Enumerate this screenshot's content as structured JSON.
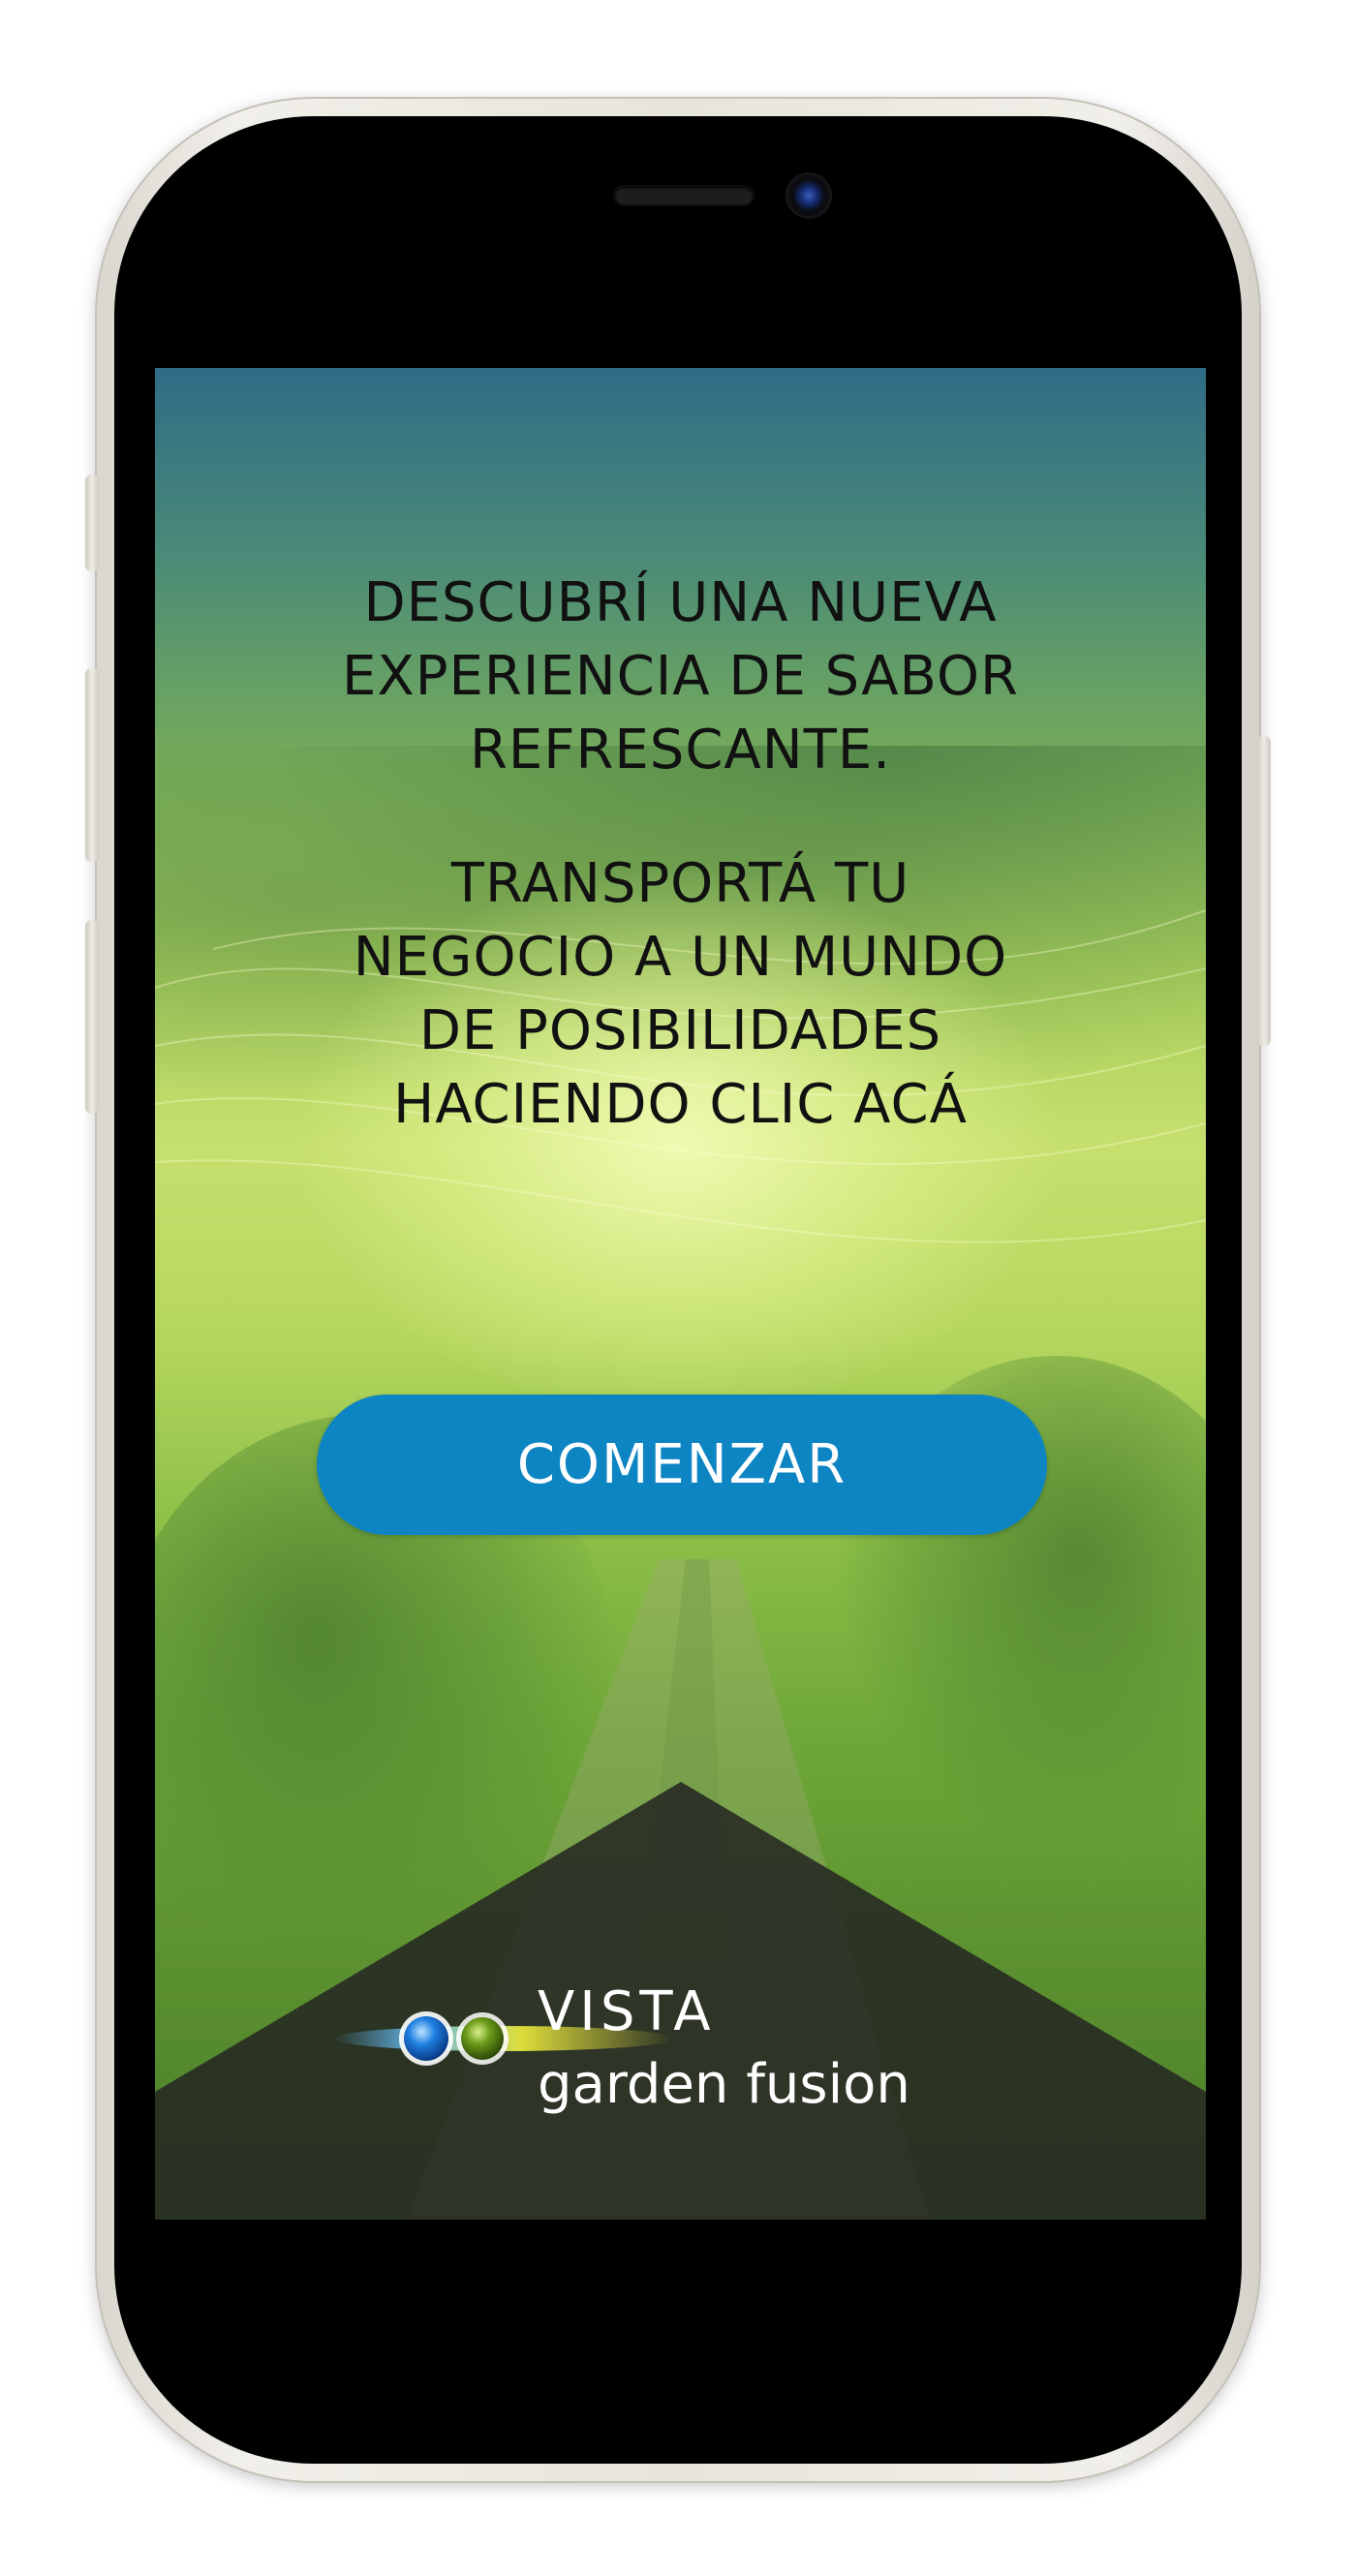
{
  "screen": {
    "headline_lines": [
      "DESCUBRÍ UNA NUEVA",
      "EXPERIENCIA DE SABOR",
      "REFRESCANTE."
    ],
    "subheadline_lines": [
      "TRANSPORTÁ TU",
      "NEGOCIO A UN MUNDO",
      "DE POSIBILIDADES",
      "HACIENDO CLIC ACÁ"
    ],
    "cta_label": "COMENZAR",
    "brand": {
      "name_top": "VISTA",
      "name_bottom": "garden fusion"
    }
  },
  "colors": {
    "cta_background": "#0d85c3",
    "cta_text": "#ffffff",
    "headline_text": "#111111",
    "brand_panel": "#2f3229",
    "logo_blue": "#1f7fe0",
    "logo_green": "#6a9a18",
    "logo_yellow": "#e6e23a"
  },
  "icons": [
    "front-camera-icon",
    "earpiece-speaker-icon",
    "vista-orbs-logo-icon"
  ]
}
